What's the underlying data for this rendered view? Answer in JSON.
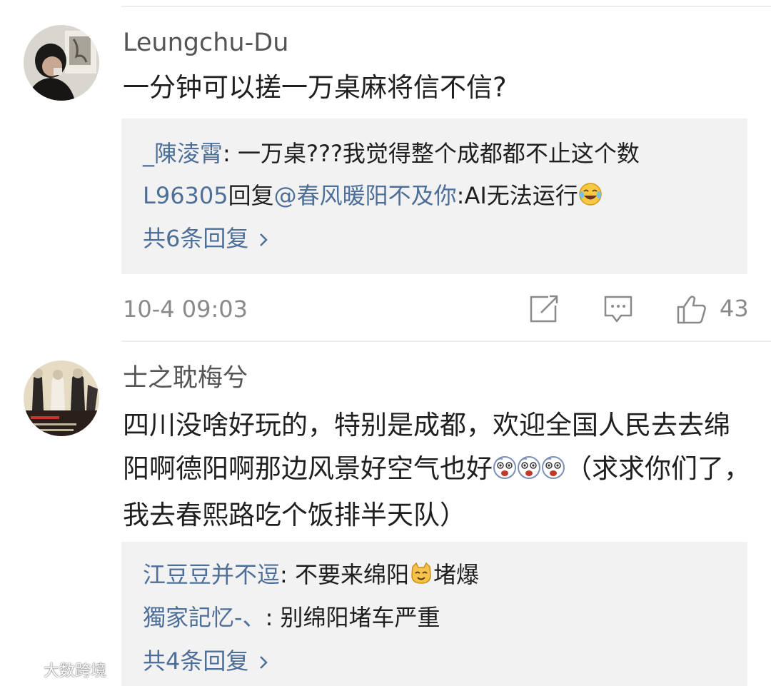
{
  "comments": [
    {
      "username": "Leungchu-Du",
      "text": "一分钟可以搓一万桌麻将信不信?",
      "replies": [
        {
          "author": "_陳淩霄",
          "sep": ": ",
          "text": "一万桌???我觉得整个成都都不止这个数"
        },
        {
          "author": "L96305",
          "mid": "回复",
          "mention": "@春风暖阳不及你",
          "sep": ":",
          "text": "AI无法运行",
          "emoji": "laugh-cry-emoji"
        }
      ],
      "more_replies": "共6条回复",
      "timestamp": "10-4 09:03",
      "likes": "43"
    },
    {
      "username": "士之耽梅兮",
      "text_before_emoji": "四川没啥好玩的，特别是成都，欢迎全国人民去去绵阳啊德阳啊那边风景好空气也好",
      "emoji": "scared-face-emoji",
      "text_after_emoji": "（求求你们了，我去春熙路吃个饭排半天队）",
      "replies": [
        {
          "author": "江豆豆并不逗",
          "sep": ": ",
          "text_before": "不要来绵阳",
          "emoji": "cat-face-emoji",
          "text_after": "堵爆"
        },
        {
          "author": "獨家記忆-、",
          "sep": ": ",
          "text": "别绵阳堵车严重"
        }
      ],
      "more_replies": "共4条回复"
    }
  ],
  "watermark": "大数跨境",
  "colors": {
    "link_blue": "#4e6f98",
    "reply_bg": "#f2f2f2",
    "meta_gray": "#8a8a8a"
  }
}
